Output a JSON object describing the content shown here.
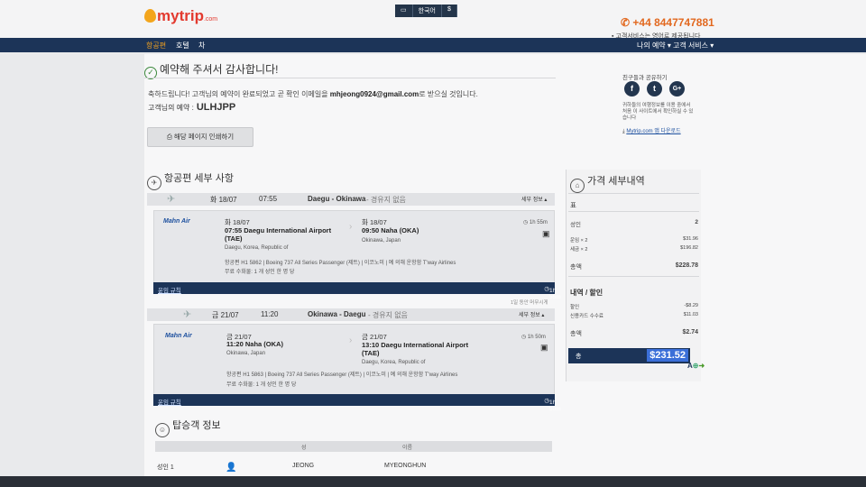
{
  "header": {
    "logo_text": "mytrip",
    "logo_suffix": ".com",
    "lang_label": "한국어",
    "currency": "$",
    "phone": "+44 8447747881",
    "phone_note": "고객서비스는 영어로 제공됩니다"
  },
  "nav": {
    "items": [
      "항공편",
      "호텔",
      "차"
    ],
    "right": [
      "나의 예약 ▾",
      "고객 서비스 ▾"
    ]
  },
  "confirmation": {
    "title": "예약해 주셔서 감사합니다!",
    "message_prefix": "축하드립니다! 고객님의 예약이 완료되었고 곧 확인 이메일을",
    "email": "mhjeong0924@gmail.com",
    "message_suffix": "로 받으실 것입니다.",
    "booking_label": "고객님의 예약 :",
    "booking_code": "ULHJPP",
    "print_button": "해당 페이지 인쇄하기"
  },
  "sidebar": {
    "share_label": "친구들과 공유하기",
    "social": [
      "f",
      "t",
      "G+"
    ],
    "info_text": "귀하들의 여행정보를 이용 중에서처음 이 사이트에서 확인하실 수 있습니다",
    "app_link": "Mytrip.com 앱 다운로드"
  },
  "flight_details": {
    "title": "항공편 세부 사항",
    "segments": [
      {
        "date": "화 18/07",
        "time": "07:55",
        "route": "Daegu - Okinawa",
        "stops": "- 경유지 없음",
        "detail_link": "세부 정보 ▴",
        "airline": "Mahn Air",
        "dep_date": "화 18/07",
        "dep_line": "07:55 Daegu International Airport",
        "dep_code": "(TAE)",
        "dep_loc": "Daegu, Korea, Republic of",
        "arr_date": "화 18/07",
        "arr_line": "09:50 Naha (OKA)",
        "arr_code": "",
        "arr_loc": "Okinawa, Japan",
        "duration": "1h 55m",
        "flight_info": "항공편 H1 5862 | Boeing 737 All Series Passenger (제트) | 이코노미 | 예 의해 운항함 T'way Airlines",
        "baggage": "무료 수화물: 1 개 성인 한 명 당",
        "rules_link": "운임 규칙",
        "footer_duration": "1h 55m"
      },
      {
        "date": "금 21/07",
        "time": "11:20",
        "route": "Okinawa - Daegu",
        "stops": "- 경유지 없음",
        "detail_link": "세부 정보 ▴",
        "note": "1일 동안 머무시게",
        "airline": "Mahn Air",
        "dep_date": "금 21/07",
        "dep_line": "11:20 Naha (OKA)",
        "dep_code": "",
        "dep_loc": "Okinawa, Japan",
        "arr_date": "금 21/07",
        "arr_line": "13:10 Daegu International Airport",
        "arr_code": "(TAE)",
        "arr_loc": "Daegu, Korea, Republic of",
        "duration": "1h 50m",
        "flight_info": "항공편 H1 5863 | Boeing 737 All Series Passenger (제트) | 이코노미 | 예 의해 운항함 T'way Airlines",
        "baggage": "무료 수화물: 1 개 성인 한 명 당",
        "rules_link": "운임 규칙",
        "footer_duration": "1h 50m"
      }
    ]
  },
  "passengers": {
    "title": "탑승객 정보",
    "headers": [
      "성",
      "이름"
    ],
    "row": {
      "type": "성인 1",
      "last": "JEONG",
      "first": "MYEONGHUN"
    }
  },
  "price": {
    "title": "가격 세부내역",
    "ticket_label": "표",
    "rows": [
      {
        "label": "성인",
        "value": "2"
      },
      {
        "label": "운임 × 2",
        "value": "$31.96"
      },
      {
        "label": "세금 × 2",
        "value": "$196.82"
      },
      {
        "label": "총액",
        "value": "$228.78"
      }
    ],
    "discount_title": "내역 / 할인",
    "discounts": [
      {
        "label": "할인",
        "value": "-$8.29"
      },
      {
        "label": "신용카드 수수료",
        "value": "$11.03"
      },
      {
        "label": "총액",
        "value": "$2.74"
      }
    ],
    "total_label": "총",
    "total_value": "$231.52"
  },
  "colors": {
    "navy": "#1c3458",
    "accent": "#e2681f",
    "link": "#1c4f9e"
  }
}
